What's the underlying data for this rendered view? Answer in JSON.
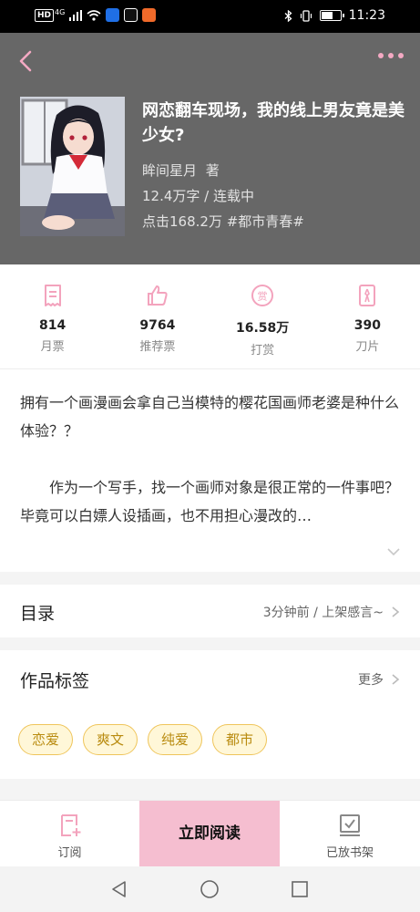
{
  "status_bar": {
    "left_indicators": [
      "HD",
      "4G"
    ],
    "time": "11:23",
    "battery_level": 0.55,
    "app_icon_colors": [
      "#1f6fe6",
      "#111111",
      "#f06a2a"
    ]
  },
  "header": {
    "title": "网恋翻车现场，我的线上男友竟是美少女?",
    "author": "眸间星月",
    "author_suffix": "著",
    "words_status": "12.4万字 / 连载中",
    "clicks_tag": "点击168.2万 #都市青春#",
    "bg_color": "#676767",
    "accent_color": "#f4a9c3"
  },
  "stats": [
    {
      "icon": "ticket-icon",
      "value": "814",
      "label": "月票"
    },
    {
      "icon": "thumbs-up-icon",
      "value": "9764",
      "label": "推荐票"
    },
    {
      "icon": "reward-coin-icon",
      "value": "16.58万",
      "label": "打赏"
    },
    {
      "icon": "blade-card-icon",
      "value": "390",
      "label": "刀片"
    }
  ],
  "synopsis": {
    "p1": "拥有一个画漫画会拿自己当模特的樱花国画师老婆是种什么体验？？",
    "p2": "作为一个写手，找一个画师对象是很正常的一件事吧？毕竟可以白嫖人设插画，也不用担心漫改的…"
  },
  "catalog": {
    "title": "目录",
    "latest": "3分钟前 / 上架感言~"
  },
  "tags_section": {
    "title": "作品标签",
    "more": "更多",
    "tags": [
      "恋爱",
      "爽文",
      "纯爱",
      "都市"
    ]
  },
  "bottom_bar": {
    "subscribe": "订阅",
    "read_now": "立即阅读",
    "shelf": "已放书架"
  }
}
